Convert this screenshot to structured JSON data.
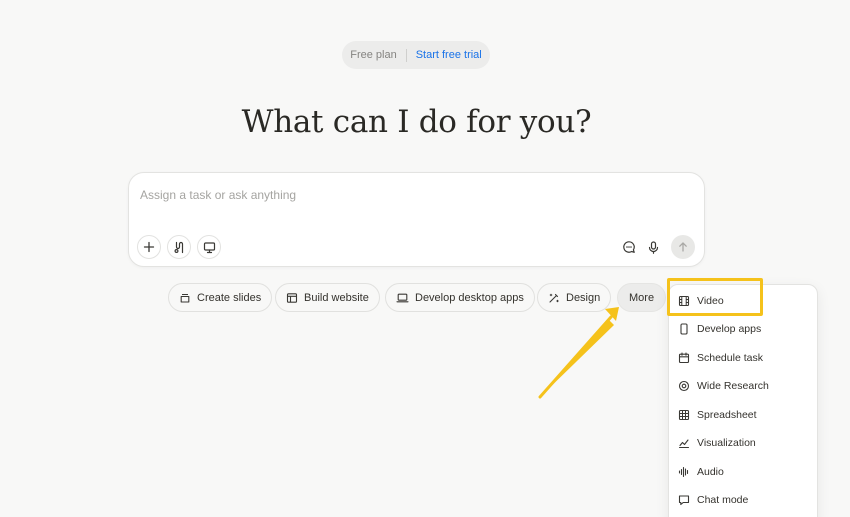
{
  "plan": {
    "label": "Free plan",
    "trial_link": "Start free trial"
  },
  "heading": "What can I do for you?",
  "composer": {
    "placeholder": "Assign a task or ask anything",
    "value": ""
  },
  "chips": [
    {
      "label": "Create slides",
      "icon": "slides-icon"
    },
    {
      "label": "Build website",
      "icon": "website-icon"
    },
    {
      "label": "Develop desktop apps",
      "icon": "laptop-icon"
    },
    {
      "label": "Design",
      "icon": "design-icon"
    },
    {
      "label": "More"
    }
  ],
  "more_menu": {
    "items": [
      {
        "label": "Video",
        "icon": "video-icon"
      },
      {
        "label": "Develop apps",
        "icon": "phone-icon"
      },
      {
        "label": "Schedule task",
        "icon": "calendar-icon"
      },
      {
        "label": "Wide Research",
        "icon": "research-icon"
      },
      {
        "label": "Spreadsheet",
        "icon": "table-icon"
      },
      {
        "label": "Visualization",
        "icon": "chart-icon"
      },
      {
        "label": "Audio",
        "icon": "audio-icon"
      },
      {
        "label": "Chat mode",
        "icon": "chat-icon"
      }
    ]
  },
  "colors": {
    "background": "#f8f8f7",
    "accent_link": "#1a73e8",
    "annotation": "#f5c21b"
  }
}
